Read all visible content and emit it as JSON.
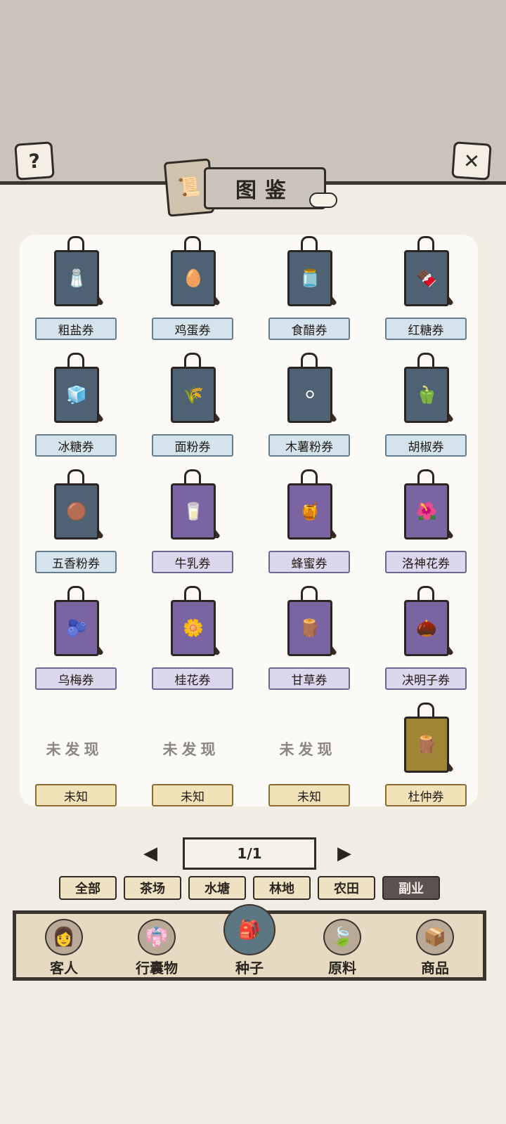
{
  "header": {
    "help_icon": "?",
    "close_icon": "✕",
    "title": "图鉴",
    "book_icon": "📜"
  },
  "items": [
    {
      "label": "粗盐券",
      "color": "blue",
      "icon": "🧂"
    },
    {
      "label": "鸡蛋券",
      "color": "blue",
      "icon": "🥚"
    },
    {
      "label": "食醋券",
      "color": "blue",
      "icon": "🫙"
    },
    {
      "label": "红糖券",
      "color": "blue",
      "icon": "🍫"
    },
    {
      "label": "冰糖券",
      "color": "blue",
      "icon": "🧊"
    },
    {
      "label": "面粉券",
      "color": "blue",
      "icon": "🌾"
    },
    {
      "label": "木薯粉券",
      "color": "blue",
      "icon": "⚪"
    },
    {
      "label": "胡椒券",
      "color": "blue",
      "icon": "🫑"
    },
    {
      "label": "五香粉券",
      "color": "blue",
      "icon": "🟤"
    },
    {
      "label": "牛乳券",
      "color": "purple",
      "icon": "🥛"
    },
    {
      "label": "蜂蜜券",
      "color": "purple",
      "icon": "🍯"
    },
    {
      "label": "洛神花券",
      "color": "purple",
      "icon": "🌺"
    },
    {
      "label": "乌梅券",
      "color": "purple",
      "icon": "🫐"
    },
    {
      "label": "桂花券",
      "color": "purple",
      "icon": "🌼"
    },
    {
      "label": "甘草券",
      "color": "purple",
      "icon": "🪵"
    },
    {
      "label": "决明子券",
      "color": "purple",
      "icon": "🌰"
    },
    {
      "label": "未知",
      "color": "gold",
      "status": "未发现"
    },
    {
      "label": "未知",
      "color": "gold",
      "status": "未发现"
    },
    {
      "label": "未知",
      "color": "gold",
      "status": "未发现"
    },
    {
      "label": "杜仲券",
      "color": "gold",
      "icon": "🪵"
    }
  ],
  "pagination": {
    "text": "1/1",
    "prev": "◀",
    "next": "▶"
  },
  "filters": [
    "全部",
    "茶场",
    "水塘",
    "林地",
    "农田",
    "副业"
  ],
  "active_filter": "副业",
  "nav": [
    {
      "label": "客人",
      "icon": "👩"
    },
    {
      "label": "行囊物",
      "icon": "👘"
    },
    {
      "label": "种子",
      "icon": "🎒",
      "active": true
    },
    {
      "label": "原料",
      "icon": "🍃"
    },
    {
      "label": "商品",
      "icon": "📦"
    }
  ],
  "colors": {
    "top_band": "#cbc3ba",
    "page_bg": "#f1ede3",
    "blue_tag": "#4f6273",
    "purple_tag": "#7a64a1",
    "gold_tag": "#a08536"
  }
}
